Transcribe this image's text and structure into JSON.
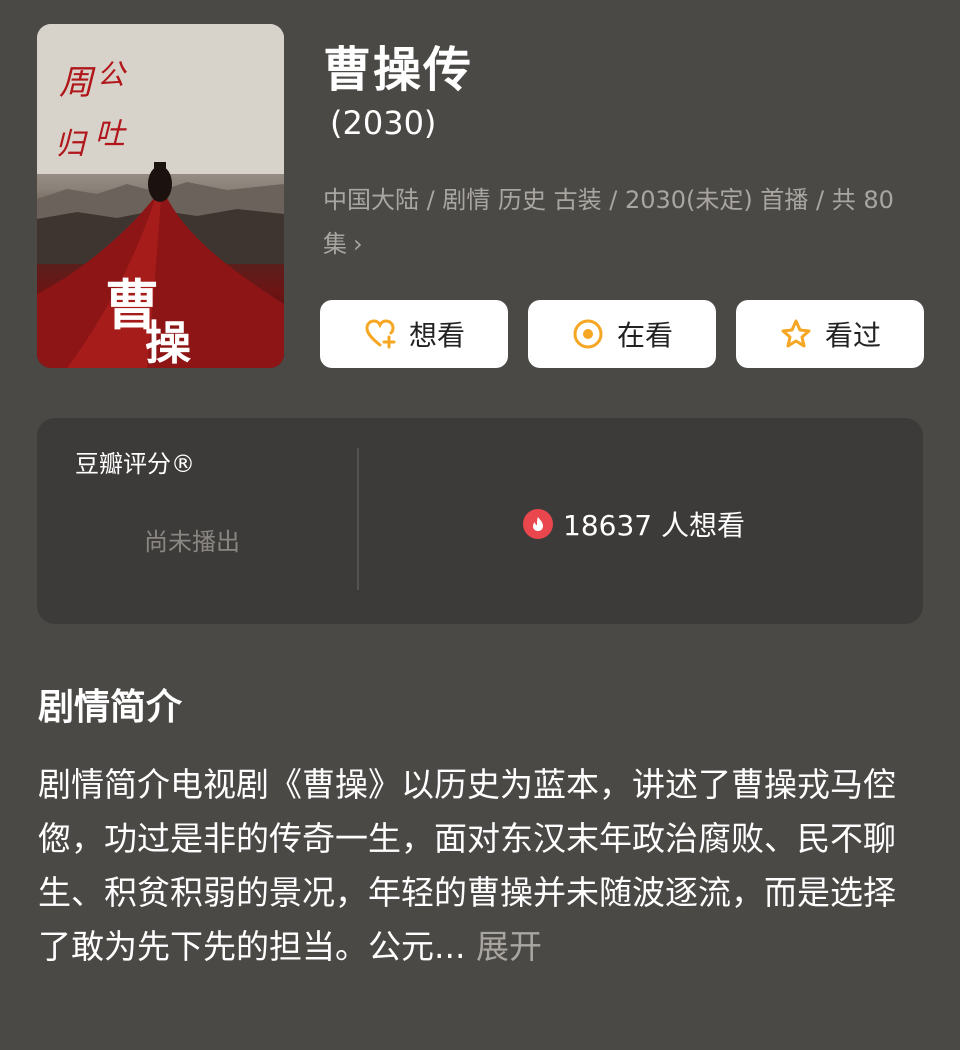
{
  "show": {
    "title": "曹操传",
    "year": "(2030)",
    "meta": "中国大陆 / 剧情 历史 古装 / 2030(未定) 首播 / 共 80集",
    "meta_chevron": "›"
  },
  "actions": [
    {
      "label": "想看",
      "icon": "heart-plus-icon"
    },
    {
      "label": "在看",
      "icon": "target-circle-icon"
    },
    {
      "label": "看过",
      "icon": "star-outline-icon"
    }
  ],
  "rating": {
    "title": "豆瓣评分®",
    "status": "尚未播出",
    "wish_count": "18637 人想看"
  },
  "synopsis": {
    "heading": "剧情简介",
    "text": "剧情简介电视剧《曹操》以历史为蓝本，讲述了曹操戎马倥偬，功过是非的传奇一生，面对东汉末年政治腐败、民不聊生、积贫积弱的景况，年轻的曹操并未随波逐流，而是选择了敢为先下先的担当。公元... ",
    "expand_label": "展开"
  },
  "colors": {
    "background": "#4b4946",
    "card": "#3d3b39",
    "accent": "#f5a623",
    "flame": "#e9474d"
  }
}
